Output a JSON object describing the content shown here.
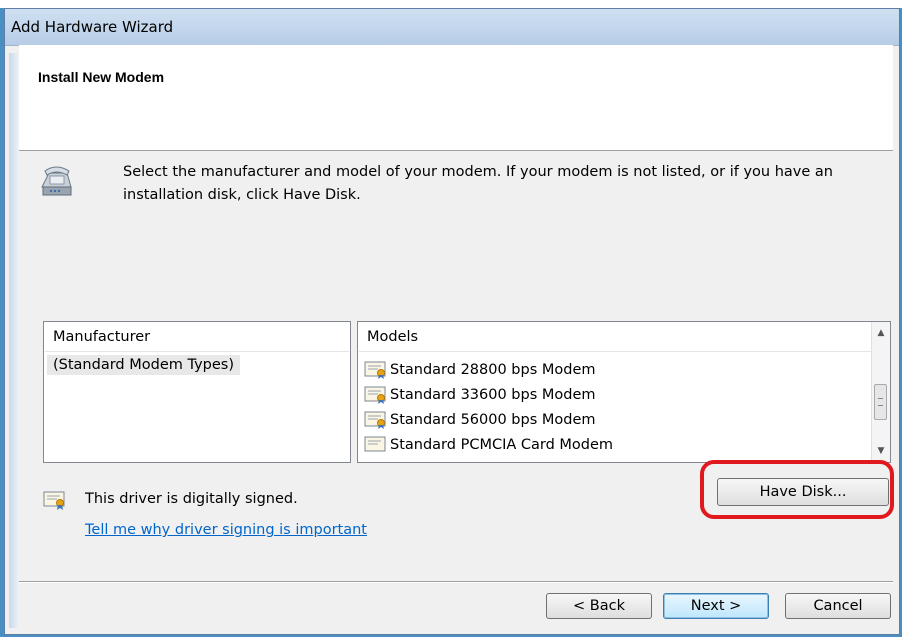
{
  "window": {
    "title": "Add Hardware Wizard"
  },
  "header": {
    "heading": "Install New Modem"
  },
  "instructions": "Select the manufacturer and model of your modem. If your modem is not listed, or if you have an installation disk, click Have Disk.",
  "manufacturer": {
    "header": "Manufacturer",
    "items": [
      "(Standard Modem Types)"
    ],
    "selected": "(Standard Modem Types)"
  },
  "models": {
    "header": "Models",
    "items": [
      "Standard 28800 bps Modem",
      "Standard 33600 bps Modem",
      "Standard 56000 bps Modem",
      "Standard PCMCIA Card Modem"
    ]
  },
  "signing": {
    "status": "This driver is digitally signed.",
    "link": "Tell me why driver signing is important"
  },
  "buttons": {
    "have_disk": "Have Disk...",
    "back": "< Back",
    "next": "Next >",
    "cancel": "Cancel"
  },
  "colors": {
    "annotation": "#e0191f",
    "link": "#0066cc",
    "selection": "#e8e8e8"
  },
  "icons": [
    "modem-icon",
    "certificate-icon",
    "scroll-up-icon",
    "scroll-down-icon"
  ]
}
